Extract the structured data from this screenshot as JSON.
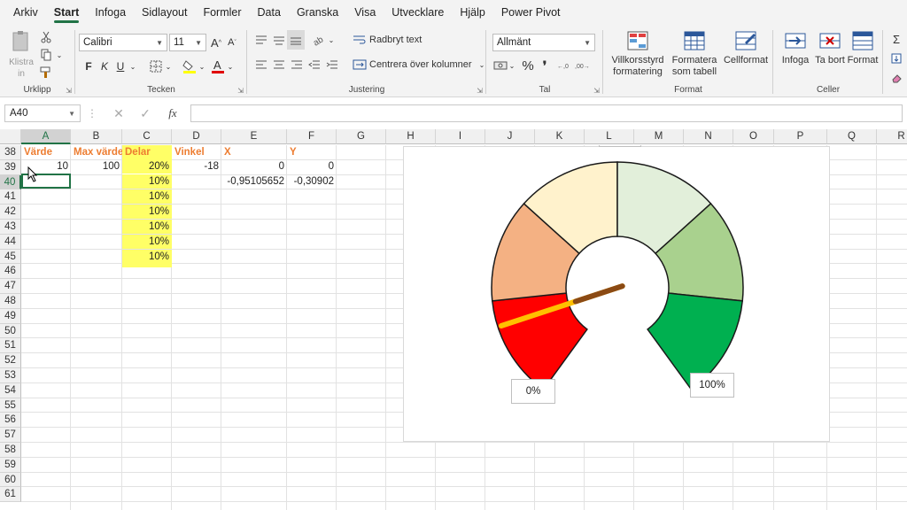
{
  "menu": [
    "Arkiv",
    "Start",
    "Infoga",
    "Sidlayout",
    "Formler",
    "Data",
    "Granska",
    "Visa",
    "Utvecklare",
    "Hjälp",
    "Power Pivot"
  ],
  "ribbon": {
    "clipboard": {
      "paste_label": "Klistra in",
      "group_label": "Urklipp"
    },
    "font": {
      "name": "Calibri",
      "size": "11",
      "group_label": "Tecken",
      "bold": "F",
      "italic": "K",
      "underline": "U"
    },
    "alignment": {
      "wrap_text": "Radbryt text",
      "merge_center": "Centrera över kolumner",
      "group_label": "Justering"
    },
    "number": {
      "format": "Allmänt",
      "group_label": "Tal",
      "percent": "%",
      "comma": "❜"
    },
    "styles": {
      "conditional": "Villkorsstyrd formatering",
      "as_table": "Formatera som tabell",
      "cell_styles": "Cellformat",
      "group_label": "Format"
    },
    "cells": {
      "insert": "Infoga",
      "delete": "Ta bort",
      "format": "Format",
      "group_label": "Celler"
    }
  },
  "formula_bar": {
    "name_box": "A40",
    "fx": "fx",
    "content": ""
  },
  "columns": [
    "A",
    "B",
    "C",
    "D",
    "E",
    "F",
    "G",
    "H",
    "I",
    "J",
    "K",
    "L",
    "M",
    "N",
    "O",
    "P",
    "Q",
    "R"
  ],
  "rows": [
    "38",
    "39",
    "40",
    "41",
    "42",
    "43",
    "44",
    "45",
    "46",
    "47",
    "48",
    "49",
    "50",
    "51",
    "52",
    "53",
    "54",
    "55",
    "56",
    "57",
    "58",
    "59",
    "60",
    "61"
  ],
  "headers": {
    "a": "Värde",
    "b": "Max värde",
    "c": "Delar",
    "d": "Vinkel",
    "e": "X",
    "f": "Y"
  },
  "row39": {
    "a": "10",
    "b": "100",
    "c": "20%",
    "d": "-18",
    "e": "0",
    "f": "0"
  },
  "row40": {
    "c": "10%",
    "e": "-0,95105652",
    "f": "-0,30902"
  },
  "c_values": [
    "10%",
    "10%",
    "10%",
    "10%",
    "10%"
  ],
  "chart": {
    "label_min": "0%",
    "label_max": "100%",
    "gauge_value_percent": 10,
    "segment_colors": [
      "#ff0000",
      "#f4b183",
      "#fff2cc",
      "#e2efda",
      "#a9d18e",
      "#00b050"
    ],
    "needle_color": "#ffc000"
  }
}
